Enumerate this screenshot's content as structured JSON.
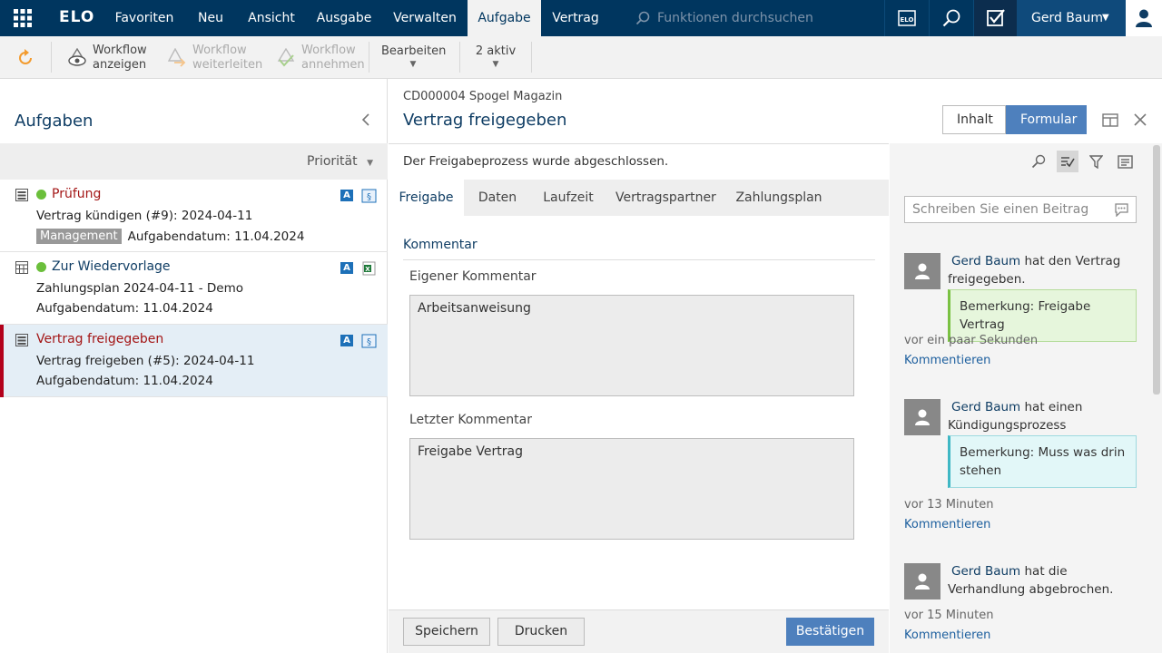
{
  "topbar": {
    "logo": "ELO",
    "menu": [
      "Favoriten",
      "Neu",
      "Ansicht",
      "Ausgabe",
      "Verwalten",
      "Aufgabe",
      "Vertrag"
    ],
    "active_menu": "Aufgabe",
    "search_placeholder": "Funktionen durchsuchen",
    "user_name": "Gerd Baum"
  },
  "ribbon": {
    "wf_show_1": "Workflow",
    "wf_show_2": "anzeigen",
    "wf_forward_1": "Workflow",
    "wf_forward_2": "weiterleiten",
    "wf_accept_1": "Workflow",
    "wf_accept_2": "annehmen",
    "edit": "Bearbeiten",
    "active": "2 aktiv"
  },
  "left": {
    "title": "Aufgaben",
    "sort_label": "Priorität",
    "tasks": [
      {
        "title": "Prüfung",
        "line2": "Vertrag kündigen (#9): 2024-04-11",
        "tag": "Management",
        "date": "Aufgabendatum: 11.04.2024"
      },
      {
        "title": "Zur Wiedervorlage",
        "line2": "Zahlungsplan 2024-04-11 - Demo",
        "date": "Aufgabendatum: 11.04.2024"
      },
      {
        "title": "Vertrag freigegeben",
        "line2": "Vertrag freigeben (#5): 2024-04-11",
        "date": "Aufgabendatum: 11.04.2024"
      }
    ],
    "badge_a": "A"
  },
  "middle": {
    "subtitle": "CD000004 Spogel Magazin",
    "title": "Vertrag freigegeben",
    "notice": "Der Freigabeprozess wurde abgeschlossen.",
    "tabs": [
      "Freigabe",
      "Daten",
      "Laufzeit",
      "Vertragspartner",
      "Zahlungsplan"
    ],
    "section": "Kommentar",
    "own_label": "Eigener Kommentar",
    "own_value": "Arbeitsanweisung",
    "last_label": "Letzter Kommentar",
    "last_value": "Freigabe Vertrag",
    "save": "Speichern",
    "print": "Drucken",
    "confirm": "Bestätigen"
  },
  "header_buttons": {
    "content": "Inhalt",
    "form": "Formular"
  },
  "feed": {
    "input_placeholder": "Schreiben Sie einen Beitrag",
    "items": [
      {
        "name": "Gerd Baum",
        "text": "hat den Vertrag freigegeben.",
        "note": "Bemerkung: Freigabe Vertrag",
        "time": "vor ein paar Sekunden",
        "link": "Kommentieren",
        "note_color": "#e6f6dc",
        "note_border": "#7ac143"
      },
      {
        "name": "Gerd Baum",
        "text": "hat einen Kündigungsprozess eingeleitet.",
        "note": "Bemerkung: Muss was drin stehen",
        "time": "vor 13 Minuten",
        "link": "Kommentieren",
        "note_color": "#e2f7f8",
        "note_border": "#3fb7c4"
      },
      {
        "name": "Gerd Baum",
        "text": "hat die Verhandlung abgebrochen.",
        "time": "vor 15 Minuten",
        "link": "Kommentieren"
      }
    ]
  }
}
